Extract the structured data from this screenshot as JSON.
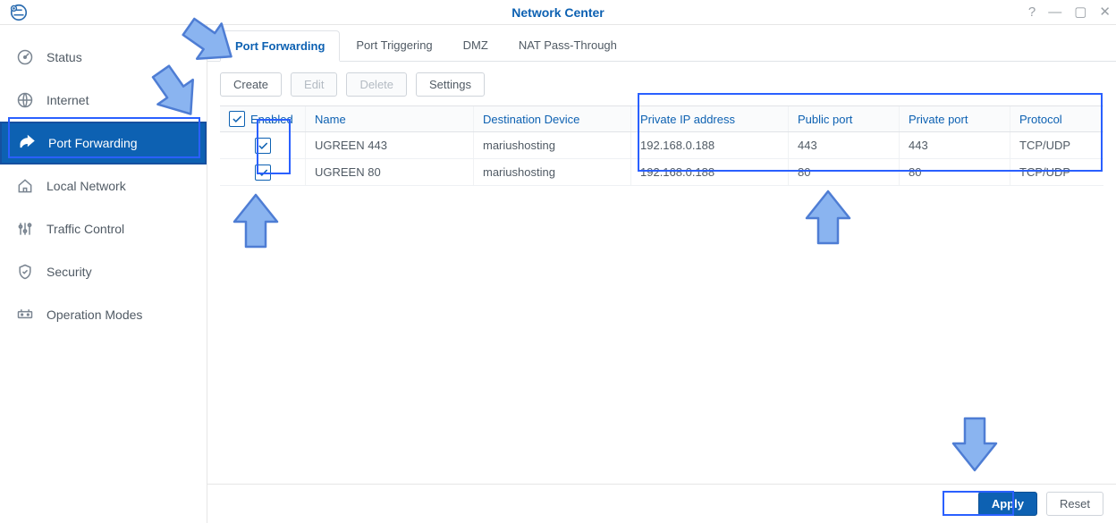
{
  "window": {
    "title": "Network Center"
  },
  "sidebar": {
    "items": [
      {
        "label": "Status"
      },
      {
        "label": "Internet"
      },
      {
        "label": "Port Forwarding"
      },
      {
        "label": "Local Network"
      },
      {
        "label": "Traffic Control"
      },
      {
        "label": "Security"
      },
      {
        "label": "Operation Modes"
      }
    ]
  },
  "tabs": [
    {
      "label": "Port Forwarding"
    },
    {
      "label": "Port Triggering"
    },
    {
      "label": "DMZ"
    },
    {
      "label": "NAT Pass-Through"
    }
  ],
  "toolbar": {
    "create": "Create",
    "edit": "Edit",
    "delete": "Delete",
    "settings": "Settings"
  },
  "table": {
    "headers": {
      "enabled": "Enabled",
      "name": "Name",
      "dest": "Destination Device",
      "ip": "Private IP address",
      "pub": "Public port",
      "priv": "Private port",
      "proto": "Protocol"
    },
    "rows": [
      {
        "enabled": true,
        "name": "UGREEN 443",
        "dest": "mariushosting",
        "ip": "192.168.0.188",
        "pub": "443",
        "priv": "443",
        "proto": "TCP/UDP"
      },
      {
        "enabled": true,
        "name": "UGREEN 80",
        "dest": "mariushosting",
        "ip": "192.168.0.188",
        "pub": "80",
        "priv": "80",
        "proto": "TCP/UDP"
      }
    ]
  },
  "footer": {
    "apply": "Apply",
    "reset": "Reset"
  }
}
